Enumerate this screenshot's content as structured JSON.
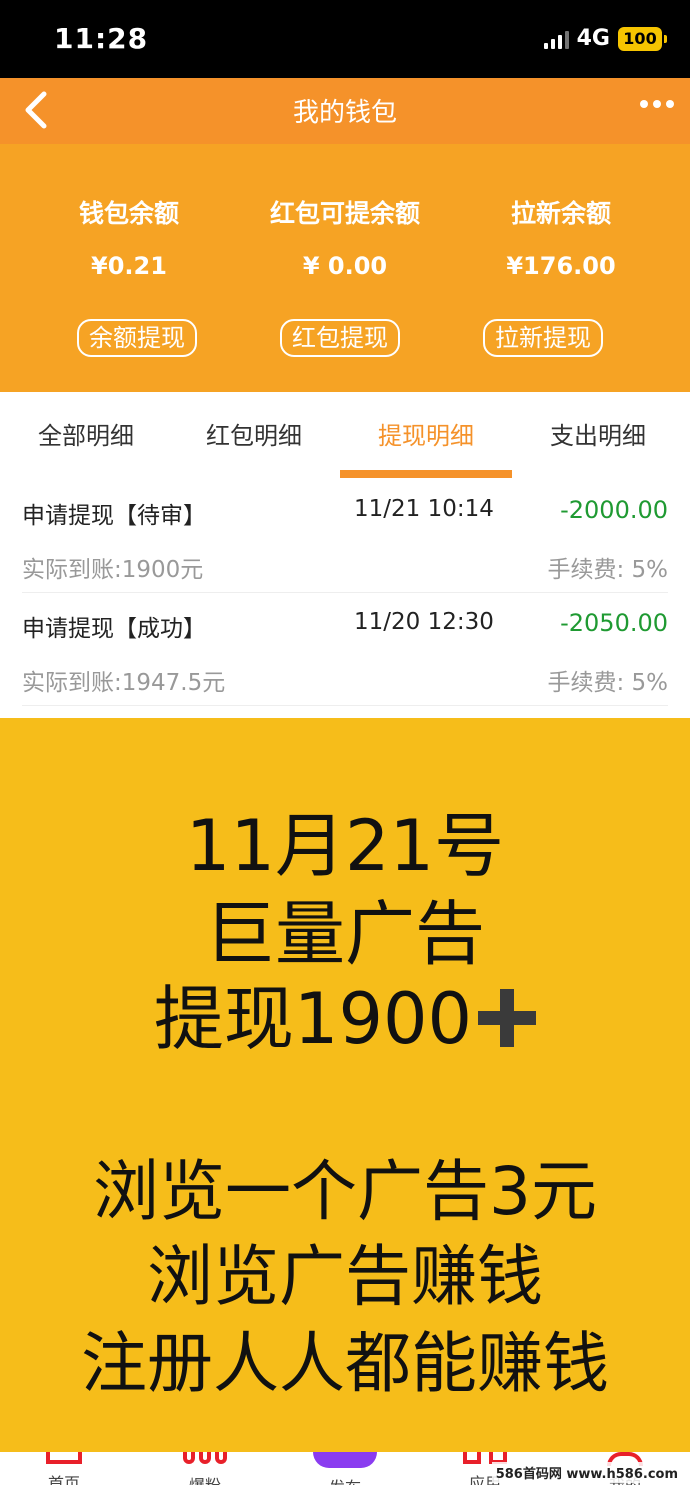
{
  "status_bar": {
    "time": "11:28",
    "network": "4G",
    "battery": "100"
  },
  "nav": {
    "title": "我的钱包",
    "back_icon": "chevron-left-icon",
    "more_icon": "more-dots-icon"
  },
  "wallet": {
    "balances": [
      {
        "label": "钱包余额",
        "amount": "¥0.21"
      },
      {
        "label": "红包可提余额",
        "amount": "¥ 0.00"
      },
      {
        "label": "拉新余额",
        "amount": "¥176.00"
      }
    ],
    "buttons": [
      {
        "label": "余额提现"
      },
      {
        "label": "红包提现"
      },
      {
        "label": "拉新提现"
      }
    ]
  },
  "tabs": [
    {
      "label": "全部明细",
      "active": false
    },
    {
      "label": "红包明细",
      "active": false
    },
    {
      "label": "提现明细",
      "active": true
    },
    {
      "label": "支出明细",
      "active": false
    }
  ],
  "records": [
    {
      "title": "申请提现【待审】",
      "time": "11/21 10:14",
      "amount": "-2000.00",
      "actual": "实际到账:1900元",
      "fee": "手续费: 5%"
    },
    {
      "title": "申请提现【成功】",
      "time": "11/20 12:30",
      "amount": "-2050.00",
      "actual": "实际到账:1947.5元",
      "fee": "手续费: 5%"
    }
  ],
  "promo": {
    "line1": "11月21号",
    "line2": "巨量广告",
    "line3": "提现1900",
    "line4": "浏览一个广告3元",
    "line5": "浏览广告赚钱",
    "line6": "注册人人都能赚钱"
  },
  "bottom_nav": [
    {
      "label": "首页",
      "icon": "home-icon"
    },
    {
      "label": "爆粉",
      "icon": "fans-icon"
    },
    {
      "label": "发布",
      "icon": "publish-icon"
    },
    {
      "label": "应用",
      "icon": "apps-icon"
    },
    {
      "label": "我的",
      "icon": "profile-icon"
    }
  ],
  "watermark": "586首码网 www.h586.com",
  "colors": {
    "nav_orange": "#f5922a",
    "header_orange": "#f6a324",
    "promo_yellow": "#f6bd1a",
    "amount_green": "#1f9a32"
  }
}
